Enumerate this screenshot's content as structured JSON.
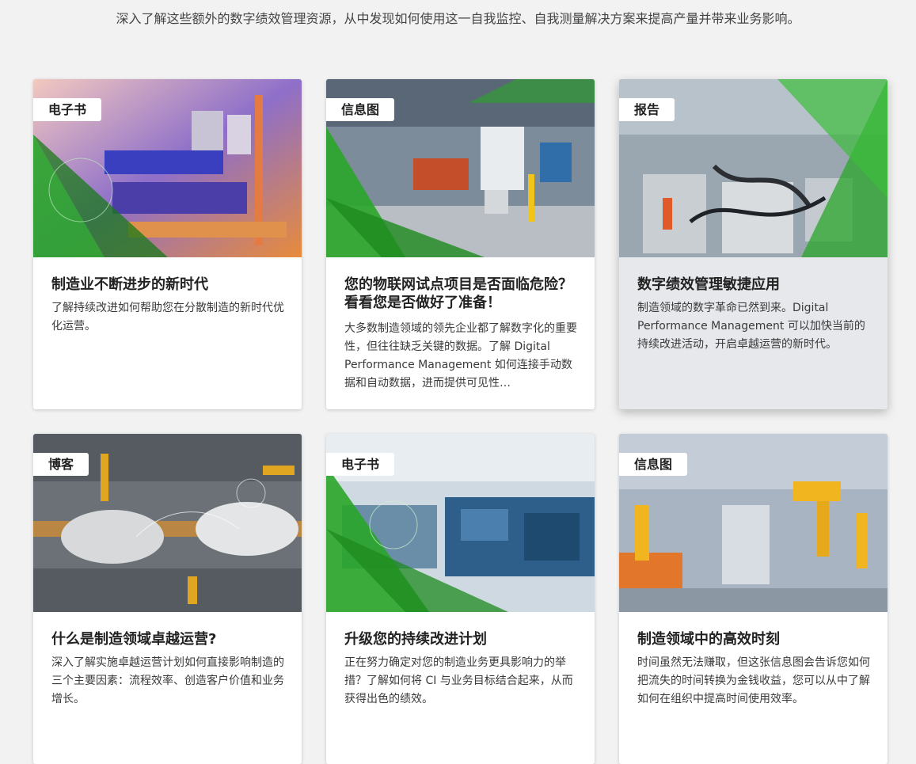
{
  "intro": "深入了解这些额外的数字绩效管理资源，从中发现如何使用这一自我监控、自我测量解决方案来提高产量并带来业务影响。",
  "cards": [
    {
      "badge": "电子书",
      "title": "制造业不断进步的新时代",
      "desc": "了解持续改进如何帮助您在分散制造的新时代优化运营。",
      "image": "plant-purple"
    },
    {
      "badge": "信息图",
      "title": "您的物联网试点项目是否面临危险？看看您是否做好了准备！",
      "desc": "大多数制造领域的领先企业都了解数字化的重要性，但往往缺乏关键的数据。了解 Digital Performance Management 如何连接手动数据和自动数据，进而提供可见性…",
      "image": "assembly-line"
    },
    {
      "badge": "报告",
      "title": "数字绩效管理敏捷应用",
      "desc": "制造领域的数字革命已然到来。Digital Performance Management 可以加快当前的持续改进活动，开启卓越运营的新时代。",
      "image": "machinery"
    },
    {
      "badge": "博客",
      "title": "什么是制造领域卓越运营?",
      "desc": "深入了解实施卓越运营计划如何直接影响制造的三个主要因素：流程效率、创造客户价值和业务增长。",
      "image": "car-line"
    },
    {
      "badge": "电子书",
      "title": "升级您的持续改进计划",
      "desc": "正在努力确定对您的制造业务更具影响力的举措？了解如何将 CI 与业务目标结合起来，从而获得出色的绩效。",
      "image": "factory-blue"
    },
    {
      "badge": "信息图",
      "title": "制造领域中的高效时刻",
      "desc": "时间虽然无法赚取，但这张信息图会告诉您如何把流失的时间转换为金钱收益，您可以从中了解如何在组织中提高时间使用效率。",
      "image": "robots-orange"
    }
  ],
  "colors": {
    "accent_green": "#2aa52a",
    "background": "#f2f2f2",
    "card_hover": "#e6e8eb"
  }
}
